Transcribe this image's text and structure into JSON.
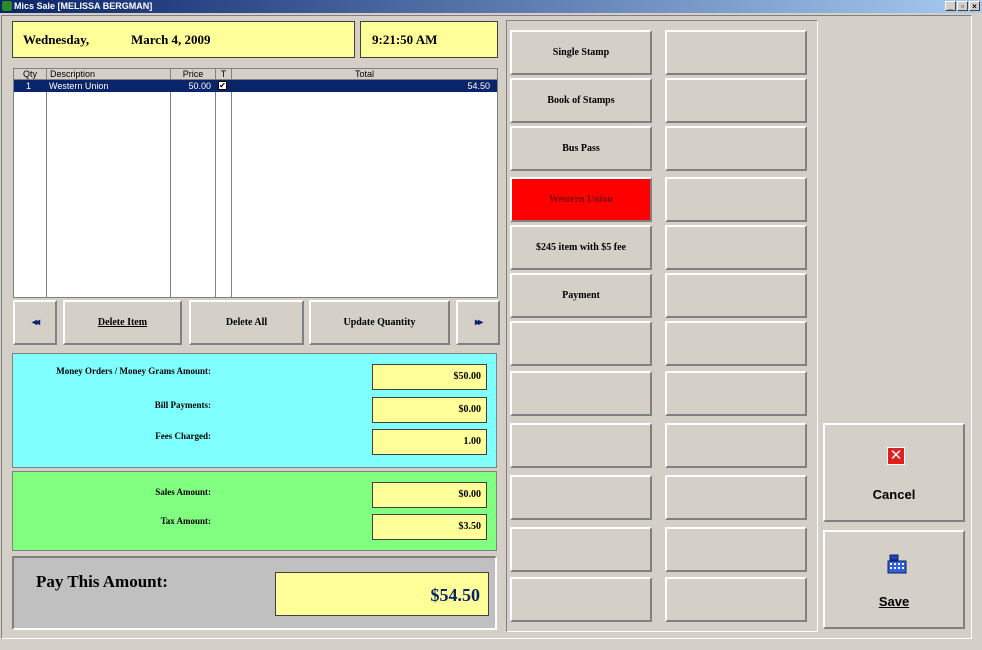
{
  "window": {
    "title": "Mics Sale [MELISSA BERGMAN]",
    "min_label": "_",
    "max_label": "▫",
    "close_label": "×"
  },
  "header": {
    "day": "Wednesday,",
    "date": "March  4, 2009",
    "time": "9:21:50 AM"
  },
  "grid": {
    "columns": [
      "Qty",
      "Description",
      "Price",
      "T",
      "Total"
    ],
    "rows": [
      {
        "qty": "1",
        "description": "Western Union",
        "price": "50.00",
        "taxable": "✔",
        "total": "54.50"
      }
    ]
  },
  "nav": {
    "prev_icon": "double-left-arrow-icon",
    "next_icon": "double-right-arrow-icon",
    "prev_label": "◂◂",
    "next_label": "▸▸",
    "delete_item": "Delete Item",
    "delete_all": "Delete All",
    "update_quantity": "Update Quantity"
  },
  "amounts": {
    "money_orders_label": "Money Orders / Money Grams Amount:",
    "money_orders_value": "$50.00",
    "bill_payments_label": "Bill Payments:",
    "bill_payments_value": "$0.00",
    "fees_label": "Fees Charged:",
    "fees_value": "1.00",
    "sales_label": "Sales Amount:",
    "sales_value": "$0.00",
    "tax_label": "Tax Amount:",
    "tax_value": "$3.50",
    "pay_label": "Pay This Amount:",
    "pay_value": "$54.50"
  },
  "item_buttons": [
    {
      "label": "Single Stamp"
    },
    {
      "label": "Book of Stamps"
    },
    {
      "label": "Bus Pass"
    },
    {
      "label": "Western Union",
      "color": "#ff0000"
    },
    {
      "label": "$245 item with $5 fee"
    },
    {
      "label": "Payment"
    }
  ],
  "actions": {
    "cancel_label": "Cancel",
    "cancel_icon": "red-x-icon",
    "cancel_glyph": "✕",
    "save_label": "Save",
    "save_icon": "cash-register-icon"
  },
  "colors": {
    "field_yellow": "#ffff99",
    "panel_cyan": "#80ffff",
    "panel_green": "#80ff80",
    "selected_row": "#0a246a",
    "highlight_button": "#ff0000"
  }
}
